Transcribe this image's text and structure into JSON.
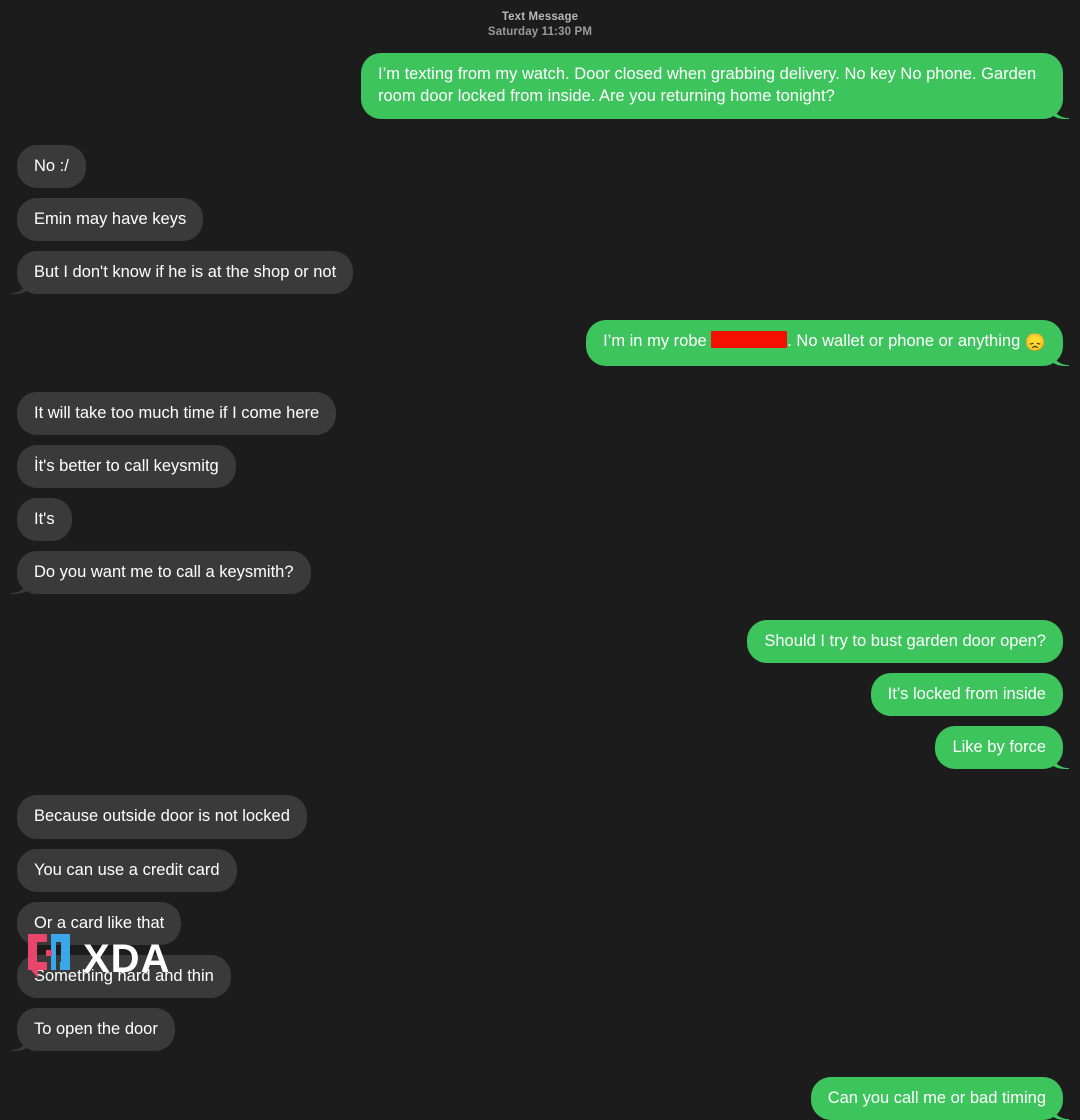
{
  "app": {
    "background_color": "#1c1c1c",
    "sent_bubble_color": "#3ec45c",
    "received_bubble_color": "#3a3a3a",
    "text_color": "#ffffff",
    "redaction_color": "#f31000"
  },
  "header": {
    "kind": "Text Message",
    "timestamp": "Saturday 11:30 PM"
  },
  "messages": [
    {
      "id": "m1",
      "side": "sent",
      "last_in_group": true,
      "text": "I’m texting from my watch. Door closed when grabbing delivery. No key No phone. Garden room door locked from inside. Are you returning home tonight?"
    },
    {
      "id": "m2",
      "side": "received",
      "last_in_group": false,
      "text": "No :/"
    },
    {
      "id": "m3",
      "side": "received",
      "last_in_group": false,
      "text": "Emin may have keys"
    },
    {
      "id": "m4",
      "side": "received",
      "last_in_group": true,
      "text": "But I don't know if he is at the shop or not"
    },
    {
      "id": "m5",
      "side": "sent",
      "last_in_group": true,
      "has_redaction": true,
      "text_before_redaction": "I’m in my robe ",
      "text_after_redaction": ". No wallet or phone or anything ",
      "emoji": "😞",
      "text": "I’m in my robe [redacted]. No wallet or phone or anything 😞"
    },
    {
      "id": "m6",
      "side": "received",
      "last_in_group": false,
      "text": "It will take too much time if I come here"
    },
    {
      "id": "m7",
      "side": "received",
      "last_in_group": false,
      "text": "İt's better to call keysmitg"
    },
    {
      "id": "m8",
      "side": "received",
      "last_in_group": false,
      "text": "It's"
    },
    {
      "id": "m9",
      "side": "received",
      "last_in_group": true,
      "text": "Do you want me to call a keysmith?"
    },
    {
      "id": "m10",
      "side": "sent",
      "last_in_group": false,
      "text": "Should I try to bust garden door open?"
    },
    {
      "id": "m11",
      "side": "sent",
      "last_in_group": false,
      "text": "It’s locked from inside"
    },
    {
      "id": "m12",
      "side": "sent",
      "last_in_group": true,
      "text": "Like by force"
    },
    {
      "id": "m13",
      "side": "received",
      "last_in_group": false,
      "text": "Because outside door is not locked"
    },
    {
      "id": "m14",
      "side": "received",
      "last_in_group": false,
      "text": "You can use a credit card"
    },
    {
      "id": "m15",
      "side": "received",
      "last_in_group": false,
      "text": "Or a card like that"
    },
    {
      "id": "m16",
      "side": "received",
      "last_in_group": false,
      "text": "Something hard and thin"
    },
    {
      "id": "m17",
      "side": "received",
      "last_in_group": true,
      "text": "To open the door"
    },
    {
      "id": "m18",
      "side": "sent",
      "last_in_group": true,
      "text": "Can you call me or bad timing"
    }
  ],
  "watermark": {
    "wordmark": "XDA",
    "bracket_left_color": "#e8456b",
    "bracket_right_color": "#3aa8e8"
  }
}
